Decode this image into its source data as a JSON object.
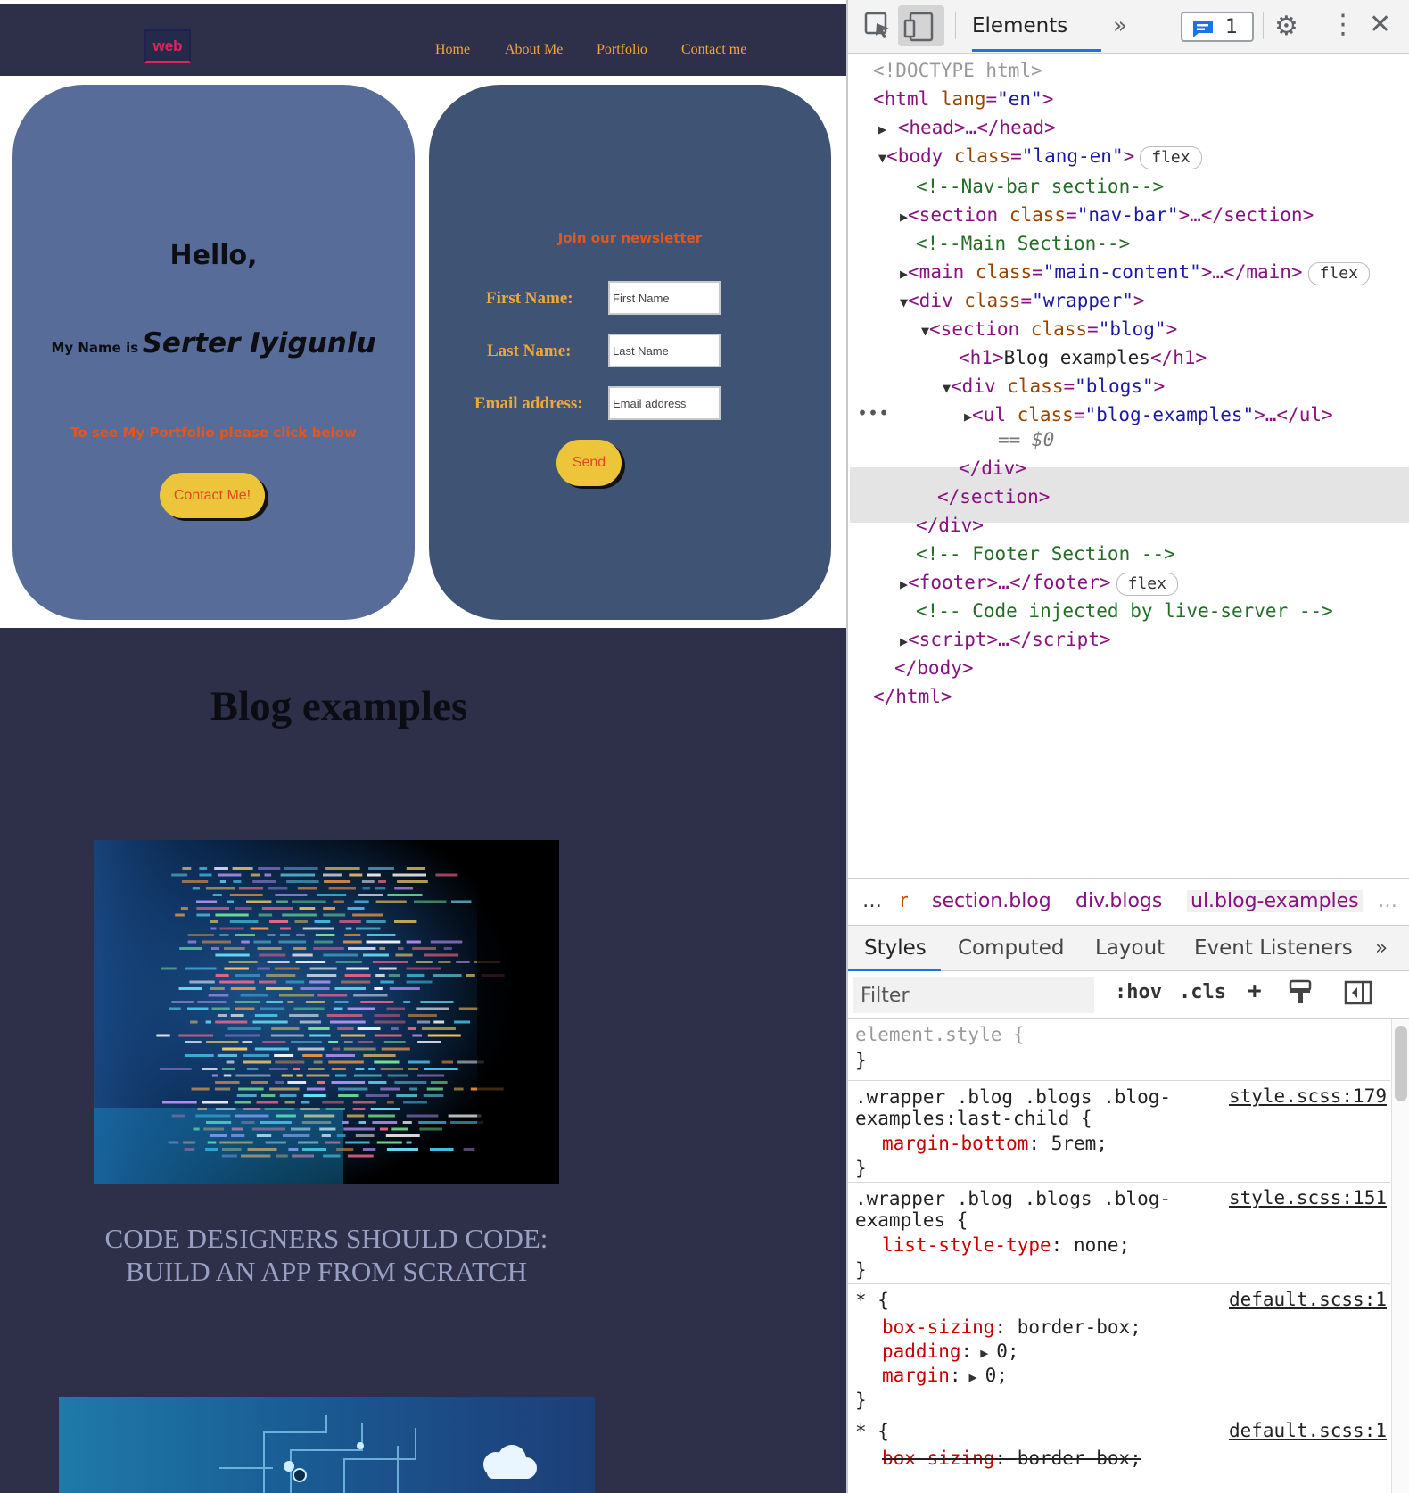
{
  "site": {
    "logo_text": "web",
    "nav_links": [
      "Home",
      "About Me",
      "Portfolio",
      "Contact me"
    ],
    "hero": {
      "greeting": "Hello,",
      "name_label": "My Name is",
      "name_value": "Serter Iyigunlu",
      "portfolio_note": "To see My Portfolio please click below",
      "contact_button": "Contact Me!"
    },
    "newsletter": {
      "title": "Join our newsletter",
      "first_name_label": "First Name:",
      "first_name_placeholder": "First Name",
      "last_name_label": "Last Name:",
      "last_name_placeholder": "Last Name",
      "email_label": "Email address:",
      "email_placeholder": "Email address",
      "send_button": "Send"
    },
    "blog": {
      "heading": "Blog examples",
      "posts": [
        {
          "caption": "CODE DESIGNERS SHOULD CODE: BUILD AN APP FROM SCRATCH"
        }
      ]
    }
  },
  "devtools": {
    "tab_active": "Elements",
    "message_count": "1",
    "dom": {
      "doctype": "<!DOCTYPE html>",
      "html_open_tag": "html",
      "lang_attr": "lang",
      "lang_value": "\"en\"",
      "head": "<head>…</head>",
      "body_tag": "body",
      "body_class_attr": "class",
      "body_class_value": "\"lang-en\"",
      "comment_nav": "<!--Nav-bar section-->",
      "section_nav_value": "\"nav-bar\"",
      "comment_main": "<!--Main Section-->",
      "main_value": "\"main-content\"",
      "div_wrapper_value": "\"wrapper\"",
      "section_blog_value": "\"blog\"",
      "h1_text": "Blog examples",
      "div_blogs_value": "\"blogs\"",
      "ul_value": "\"blog-examples\"",
      "selected_marker": "== $0",
      "comment_footer": "<!-- Footer Section -->",
      "comment_live": "<!-- Code injected by live-server -->",
      "flex_badge": "flex"
    },
    "breadcrumbs": [
      "…",
      "r",
      "section.blog",
      "div.blogs",
      "ul.blog-examples",
      "…"
    ],
    "sub_tabs": [
      "Styles",
      "Computed",
      "Layout",
      "Event Listeners"
    ],
    "filter_placeholder": "Filter",
    "filter_buttons": [
      ":hov",
      ".cls",
      "+"
    ],
    "styles": [
      {
        "selector": "element.style {",
        "close": "}"
      },
      {
        "selector_line1": ".wrapper .blog .blogs .blog-",
        "selector_line2": "examples:last-child {",
        "source": "style.scss:179",
        "prop": "margin-bottom",
        "value": "5rem;",
        "close": "}"
      },
      {
        "selector_line1": ".wrapper .blog .blogs .blog-",
        "selector_line2": "examples {",
        "source": "style.scss:151",
        "prop": "list-style-type",
        "value": "none;",
        "close": "}"
      },
      {
        "selector": "* {",
        "source": "default.scss:1",
        "props": [
          {
            "prop": "box-sizing",
            "value": "border-box;"
          },
          {
            "prop": "padding",
            "value": "0;"
          },
          {
            "prop": "margin",
            "value": "0;"
          }
        ],
        "close": "}"
      },
      {
        "selector": "* {",
        "source": "default.scss:1",
        "prop": "box-sizing",
        "value": "border-box;"
      }
    ]
  },
  "colors": {
    "page_dark": "#2d3048",
    "hero_card": "#576c99",
    "news_card": "#3f5474",
    "accent_orange": "#f0a73a",
    "accent_red": "#e2561f",
    "button_yellow": "#ecc53a",
    "devtools_blue": "#1a73e8"
  }
}
